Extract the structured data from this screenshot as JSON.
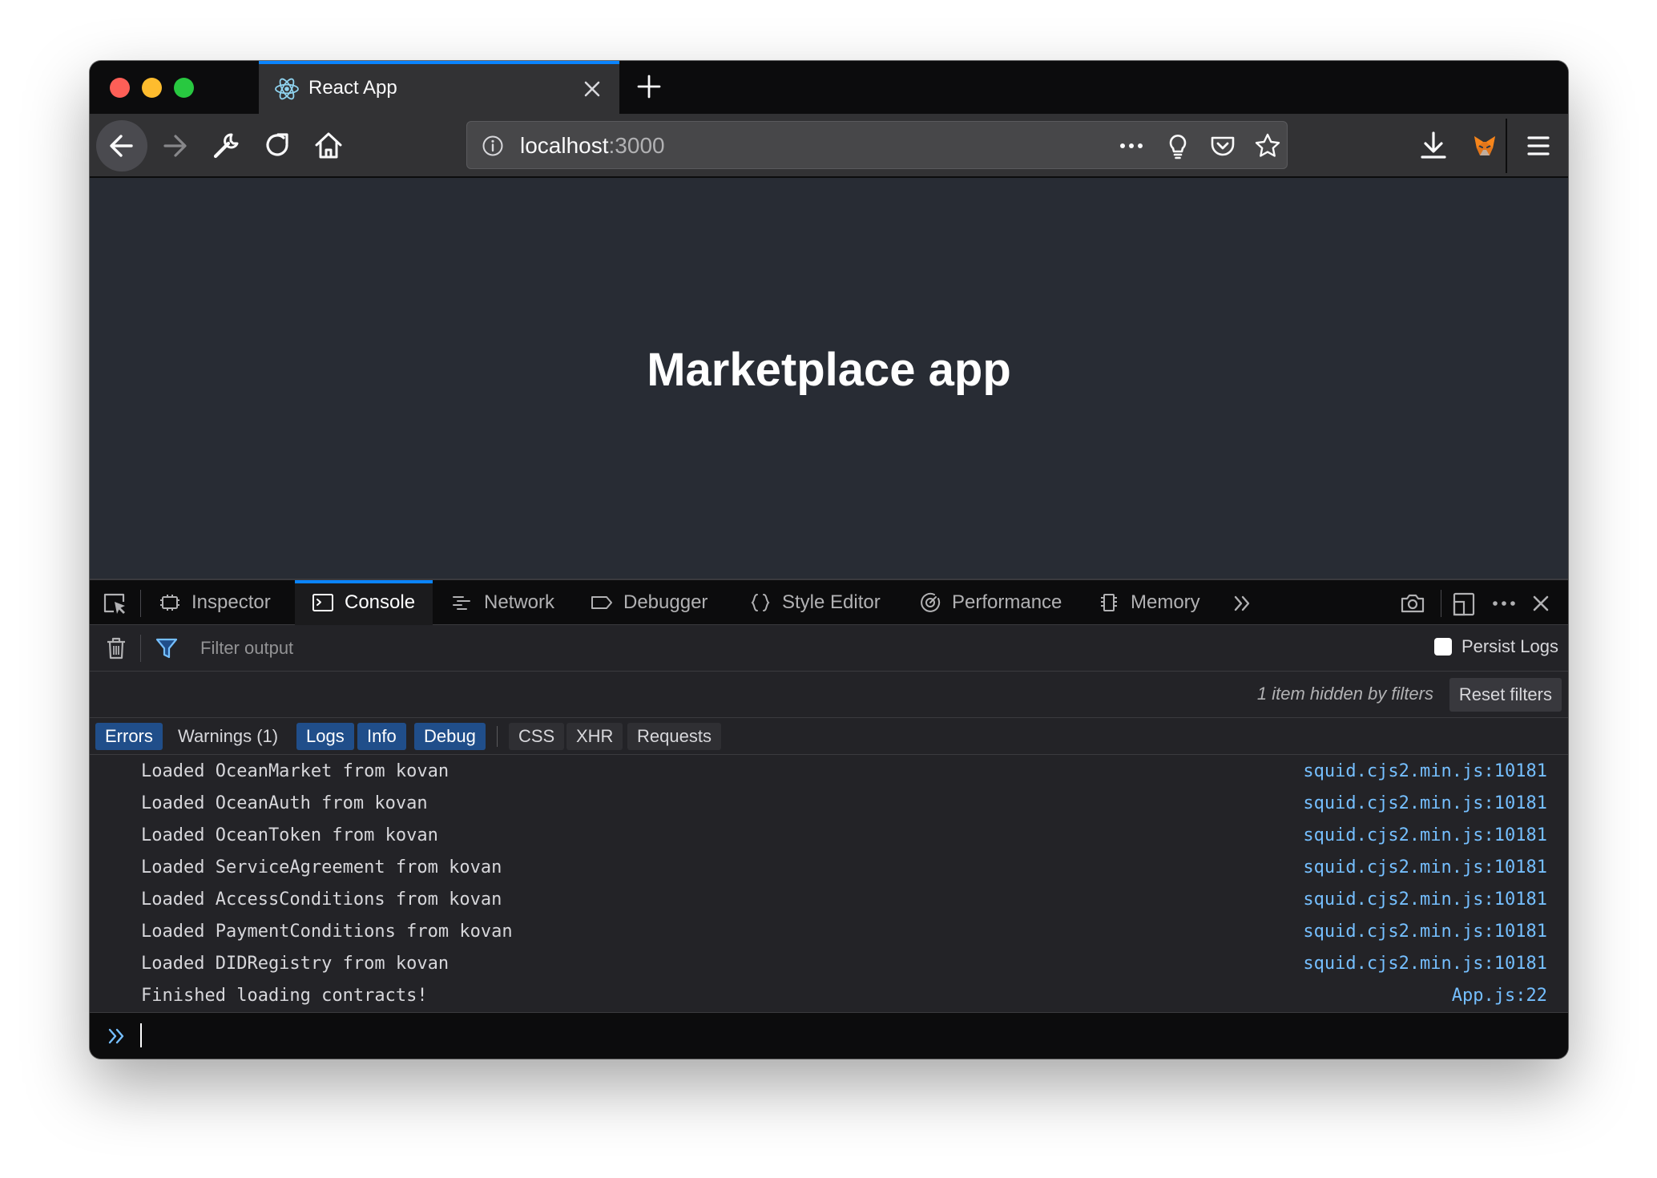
{
  "browser": {
    "tab": {
      "title": "React App",
      "favicon": "react-atom-icon"
    },
    "url": {
      "host": "localhost",
      "port": ":3000"
    },
    "colors": {
      "accent": "#0a84ff",
      "toolbar": "#323234",
      "frame": "#0c0c0d"
    }
  },
  "page": {
    "title": "Marketplace app",
    "background": "#282c34"
  },
  "devtools": {
    "tabs": [
      {
        "label": "Inspector",
        "icon": "inspector-icon"
      },
      {
        "label": "Console",
        "icon": "console-icon",
        "selected": true
      },
      {
        "label": "Network",
        "icon": "network-icon"
      },
      {
        "label": "Debugger",
        "icon": "debugger-icon"
      },
      {
        "label": "Style Editor",
        "icon": "style-editor-icon"
      },
      {
        "label": "Performance",
        "icon": "performance-icon"
      },
      {
        "label": "Memory",
        "icon": "memory-icon"
      }
    ],
    "filter": {
      "placeholder": "Filter output",
      "persist_logs_label": "Persist Logs",
      "persist_logs_checked": false
    },
    "hidden_message": "1 item hidden by filters",
    "reset_filters_label": "Reset filters",
    "levels": [
      {
        "label": "Errors",
        "active": true
      },
      {
        "label": "Warnings (1)",
        "active": false
      },
      {
        "label": "Logs",
        "active": true
      },
      {
        "label": "Info",
        "active": true
      },
      {
        "label": "Debug",
        "active": true
      }
    ],
    "categories": [
      {
        "label": "CSS",
        "active": false
      },
      {
        "label": "XHR",
        "active": false
      },
      {
        "label": "Requests",
        "active": false
      }
    ],
    "messages": [
      {
        "text": "Loaded OceanMarket from kovan",
        "source": "squid.cjs2.min.js:10181"
      },
      {
        "text": "Loaded OceanAuth from kovan",
        "source": "squid.cjs2.min.js:10181"
      },
      {
        "text": "Loaded OceanToken from kovan",
        "source": "squid.cjs2.min.js:10181"
      },
      {
        "text": "Loaded ServiceAgreement from kovan",
        "source": "squid.cjs2.min.js:10181"
      },
      {
        "text": "Loaded AccessConditions from kovan",
        "source": "squid.cjs2.min.js:10181"
      },
      {
        "text": "Loaded PaymentConditions from kovan",
        "source": "squid.cjs2.min.js:10181"
      },
      {
        "text": "Loaded DIDRegistry from kovan",
        "source": "squid.cjs2.min.js:10181"
      },
      {
        "text": "Finished loading contracts!",
        "source": "App.js:22"
      }
    ]
  }
}
